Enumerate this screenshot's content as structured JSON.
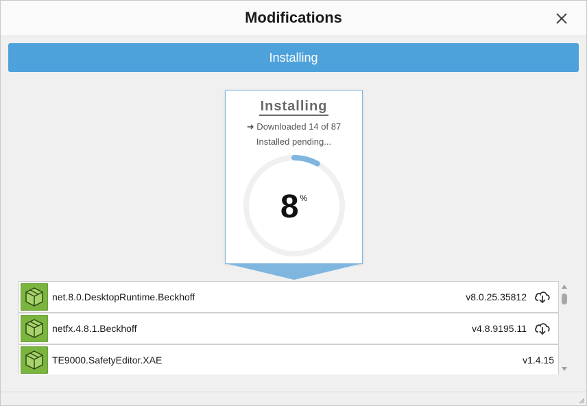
{
  "window": {
    "title": "Modifications",
    "close_icon": "close-icon"
  },
  "banner": {
    "label": "Installing"
  },
  "progress_card": {
    "title": "Installing",
    "downloaded_text": "➜ Downloaded 14 of 87",
    "installed_text": "Installed pending...",
    "percent": "8",
    "percent_unit": "%",
    "percent_value": 8,
    "ring_color": "#7fb6e0",
    "ring_track_color": "#f0f0f0"
  },
  "packages": [
    {
      "name": "net.8.0.DesktopRuntime.Beckhoff",
      "version": "v8.0.25.35812",
      "icon": "package-icon",
      "action_icon": "cloud-download-icon"
    },
    {
      "name": "netfx.4.8.1.Beckhoff",
      "version": "v4.8.9195.11",
      "icon": "package-icon",
      "action_icon": "cloud-download-icon"
    },
    {
      "name": "TE9000.SafetyEditor.XAE",
      "version": "v1.4.15",
      "icon": "package-icon",
      "action_icon": ""
    }
  ],
  "colors": {
    "accent": "#4ea2dc",
    "package_green": "#7bb540"
  }
}
